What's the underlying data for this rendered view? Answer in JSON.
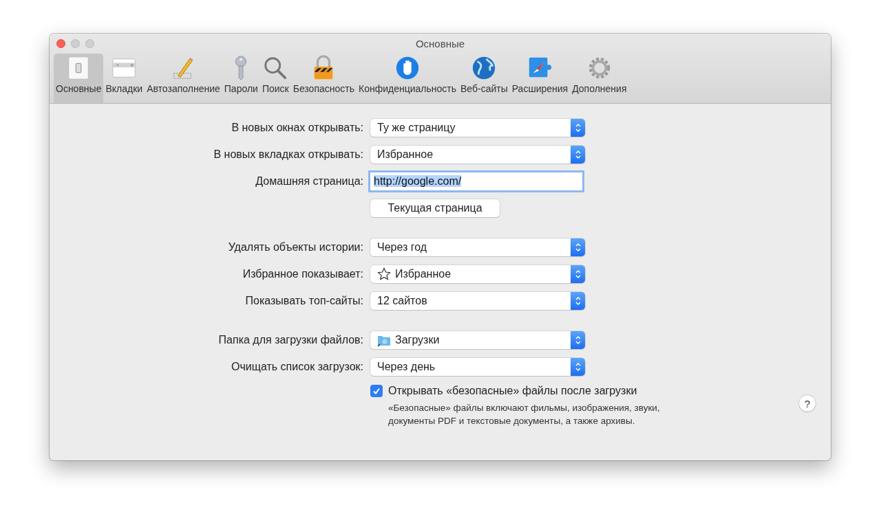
{
  "window": {
    "title": "Основные"
  },
  "toolbar": [
    {
      "label": "Основные",
      "selected": true
    },
    {
      "label": "Вкладки",
      "selected": false
    },
    {
      "label": "Автозаполнение",
      "selected": false
    },
    {
      "label": "Пароли",
      "selected": false
    },
    {
      "label": "Поиск",
      "selected": false
    },
    {
      "label": "Безопасность",
      "selected": false
    },
    {
      "label": "Конфиденциальность",
      "selected": false
    },
    {
      "label": "Веб-сайты",
      "selected": false
    },
    {
      "label": "Расширения",
      "selected": false
    },
    {
      "label": "Дополнения",
      "selected": false
    }
  ],
  "groups": [
    [
      {
        "kind": "popup",
        "label": "В новых окнах открывать:",
        "value": "Ту же страницу"
      },
      {
        "kind": "popup",
        "label": "В новых вкладках открывать:",
        "value": "Избранное"
      },
      {
        "kind": "field",
        "label": "Домашняя страница:",
        "value": "http://google.com/",
        "focused": true
      },
      {
        "kind": "button",
        "value": "Текущая страница"
      }
    ],
    [
      {
        "kind": "popup",
        "label": "Удалять объекты истории:",
        "value": "Через год"
      },
      {
        "kind": "starpopup",
        "label": "Избранное показывает:",
        "value": "Избранное"
      },
      {
        "kind": "popup",
        "label": "Показывать топ-сайты:",
        "value": "12 сайтов"
      }
    ],
    [
      {
        "kind": "folderpopup",
        "label": "Папка для загрузки файлов:",
        "value": "Загрузки"
      },
      {
        "kind": "popup",
        "label": "Очищать список загрузок:",
        "value": "Через день"
      },
      {
        "kind": "checkbox",
        "value": "Открывать «безопасные» файлы после загрузки",
        "checked": true,
        "note": "«Безопасные» файлы включают фильмы, изображения, звуки, документы PDF и текстовые документы, а также архивы."
      }
    ]
  ],
  "help": "?"
}
